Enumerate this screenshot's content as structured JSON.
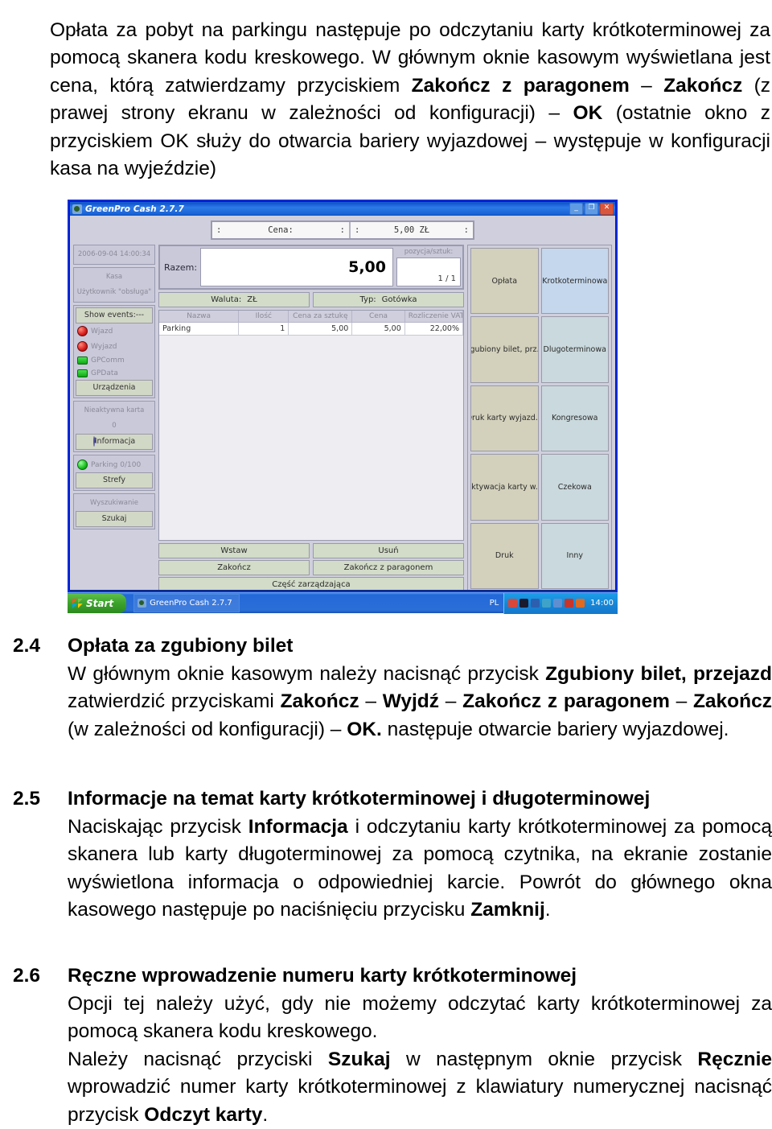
{
  "intro_paragraph": {
    "runs": [
      {
        "t": "Opłata za pobyt na parkingu następuje po odczytaniu karty krótkoterminowej za pomocą skanera kodu kreskowego. W głównym oknie kasowym wyświetlana jest cena, którą zatwierdzamy przyciskiem ",
        "b": false
      },
      {
        "t": "Zakończ z paragonem",
        "b": true
      },
      {
        "t": " – ",
        "b": false
      },
      {
        "t": "Zakończ",
        "b": true
      },
      {
        "t": " (z prawej strony ekranu w zależności od konfiguracji) – ",
        "b": false
      },
      {
        "t": "OK",
        "b": true
      },
      {
        "t": " (ostatnie okno z przyciskiem OK służy do otwarcia bariery wyjazdowej – występuje w konfiguracji kasa na wyjeździe)",
        "b": false
      }
    ]
  },
  "sections": [
    {
      "number": "2.4",
      "title": "Opłata za zgubiony bilet",
      "runs": [
        {
          "t": "W głównym oknie kasowym należy nacisnąć przycisk ",
          "b": false
        },
        {
          "t": "Zgubiony bilet, przejazd",
          "b": true
        },
        {
          "t": " zatwierdzić przyciskami ",
          "b": false
        },
        {
          "t": "Zakończ",
          "b": true
        },
        {
          "t": " – ",
          "b": false
        },
        {
          "t": "Wyjdź",
          "b": true
        },
        {
          "t": " – ",
          "b": false
        },
        {
          "t": "Zakończ z paragonem",
          "b": true
        },
        {
          "t": " – ",
          "b": false
        },
        {
          "t": "Zakończ",
          "b": true
        },
        {
          "t": " (w zależności od konfiguracji) – ",
          "b": false
        },
        {
          "t": "OK.",
          "b": true
        },
        {
          "t": " następuje otwarcie bariery wyjazdowej.",
          "b": false
        }
      ]
    },
    {
      "number": "2.5",
      "title": "Informacje na temat karty krótkoterminowej i długoterminowej",
      "runs": [
        {
          "t": "Naciskając przycisk ",
          "b": false
        },
        {
          "t": "Informacja",
          "b": true
        },
        {
          "t": " i odczytaniu karty krótkoterminowej za pomocą skanera lub karty długoterminowej za pomocą czytnika, na ekranie zostanie wyświetlona informacja o odpowiedniej karcie. Powrót do głównego okna kasowego następuje po naciśnięciu przycisku ",
          "b": false
        },
        {
          "t": "Zamknij",
          "b": true
        },
        {
          "t": ".",
          "b": false
        }
      ]
    },
    {
      "number": "2.6",
      "title": "Ręczne wprowadzenie numeru karty krótkoterminowej",
      "runs": [
        {
          "t": "Opcji tej należy użyć, gdy nie możemy odczytać karty krótkoterminowej za pomocą skanera kodu kreskowego.",
          "b": false
        },
        {
          "t": "\n",
          "b": false
        },
        {
          "t": "Należy nacisnąć przyciski ",
          "b": false
        },
        {
          "t": "Szukaj",
          "b": true
        },
        {
          "t": " w następnym oknie przycisk ",
          "b": false
        },
        {
          "t": "Ręcznie",
          "b": true
        },
        {
          "t": " wprowadzić numer karty krótkoterminowej z klawiatury numerycznej nacisnąć przycisk ",
          "b": false
        },
        {
          "t": "Odczyt karty",
          "b": true
        },
        {
          "t": ".",
          "b": false
        }
      ]
    }
  ],
  "figure": {
    "window": {
      "title": "GreenPro Cash 2.7.7",
      "minimize_label": "_",
      "maximize_label": "❐",
      "close_label": "✕"
    },
    "lcd": {
      "left_start": ":",
      "left_text": "Cena:",
      "left_end": ":",
      "right_start": ":",
      "right_text": "5,00 ZŁ",
      "right_end": ":"
    },
    "sidebar": {
      "datetime": "2006-09-04 14:00:34",
      "station_line1": "Kasa",
      "station_line2": "Użytkownik \"obsługa\"",
      "show_events": "Show events:---",
      "entry_label": "Wjazd",
      "exit_label": "Wyjazd",
      "gpcomm_label": "GPComm",
      "gpdata_label": "GPData",
      "devices_button": "Urządzenia",
      "inactive_card_label": "Nieaktywna karta",
      "inactive_card_count": "0",
      "info_button": "Informacja",
      "parking_status": "Parking 0/100",
      "zones_button": "Strefy",
      "search_label": "Wyszukiwanie",
      "search_button": "Szukaj"
    },
    "total": {
      "label": "Razem:",
      "value": "5,00",
      "positions_label": "pozycja/sztuk:",
      "positions_value": "1 / 1"
    },
    "meta": {
      "currency_label": "Waluta:",
      "currency_value": "ZŁ",
      "type_label": "Typ:",
      "type_value": "Gotówka"
    },
    "table": {
      "columns": [
        "Nazwa",
        "Ilość",
        "Cena za sztukę",
        "Cena",
        "Rozliczenie VAT"
      ],
      "rows": [
        {
          "name": "Parking",
          "qty": "1",
          "unit_price": "5,00",
          "price": "5,00",
          "vat": "22,00%"
        }
      ]
    },
    "commands": [
      [
        "Wstaw",
        "Usuń"
      ],
      [
        "Zakończ",
        "Zakończ z paragonem"
      ]
    ],
    "command_wide": "Część zarządzająca",
    "keypad": [
      {
        "label": "Opłata",
        "style": "tan"
      },
      {
        "label": "Krotkoterminowa",
        "style": "blue"
      },
      {
        "label": "Zgubiony bilet, prz...",
        "style": "tan"
      },
      {
        "label": "Dlugoterminowa",
        "style": "blue2"
      },
      {
        "label": "Druk karty wyjazd...",
        "style": "tan"
      },
      {
        "label": "Kongresowa",
        "style": "blue2"
      },
      {
        "label": "Aktywacja karty w...",
        "style": "tan"
      },
      {
        "label": "Czekowa",
        "style": "blue2"
      },
      {
        "label": "Druk",
        "style": "tan"
      },
      {
        "label": "Inny",
        "style": "blue2"
      }
    ],
    "taskbar": {
      "start_label": "Start",
      "task_label": "GreenPro Cash 2.7.7",
      "language": "PL",
      "clock": "14:00",
      "tray_colors": [
        "#e06a1f",
        "#c8342a",
        "#5f8fd0",
        "#3fa2c8",
        "#2d5fb0",
        "#1a1a2e",
        "#d8473a"
      ]
    }
  }
}
